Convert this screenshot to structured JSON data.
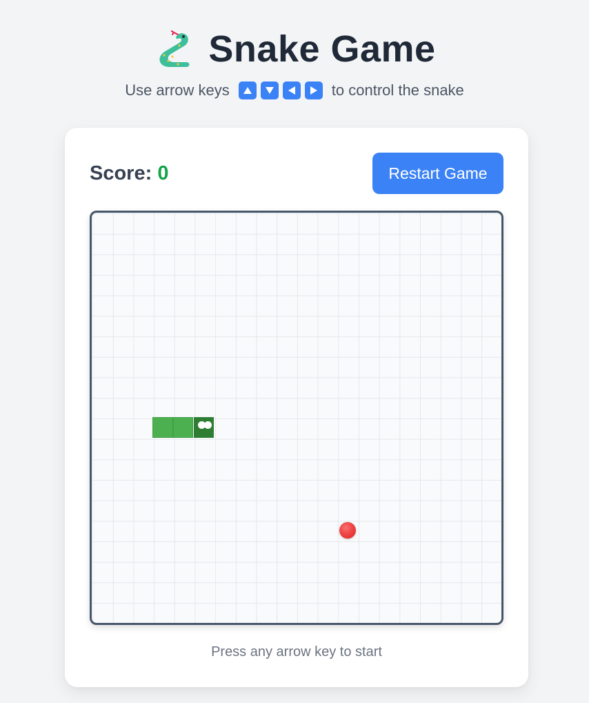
{
  "header": {
    "logo_icon": "snake-emoji-icon",
    "title": "Snake Game",
    "subtitle_before": "Use arrow keys",
    "subtitle_after": "to control the snake",
    "key_icons": [
      "arrow-up-icon",
      "arrow-down-icon",
      "arrow-left-icon",
      "arrow-right-icon"
    ]
  },
  "scoreboard": {
    "label": "Score:",
    "value": "0"
  },
  "restart_button": {
    "label": "Restart Game"
  },
  "game": {
    "grid_cells": 20,
    "snake": [
      {
        "col": 5,
        "row": 10,
        "head": true
      },
      {
        "col": 4,
        "row": 10,
        "head": false
      },
      {
        "col": 3,
        "row": 10,
        "head": false
      }
    ],
    "food": {
      "col": 12,
      "row": 15
    },
    "colors": {
      "snake_body": "#4caf50",
      "snake_head": "#2e7d32",
      "food": "#ef4444",
      "accent": "#3b82f6",
      "score": "#16a34a"
    }
  },
  "status": {
    "hint": "Press any arrow key to start"
  }
}
